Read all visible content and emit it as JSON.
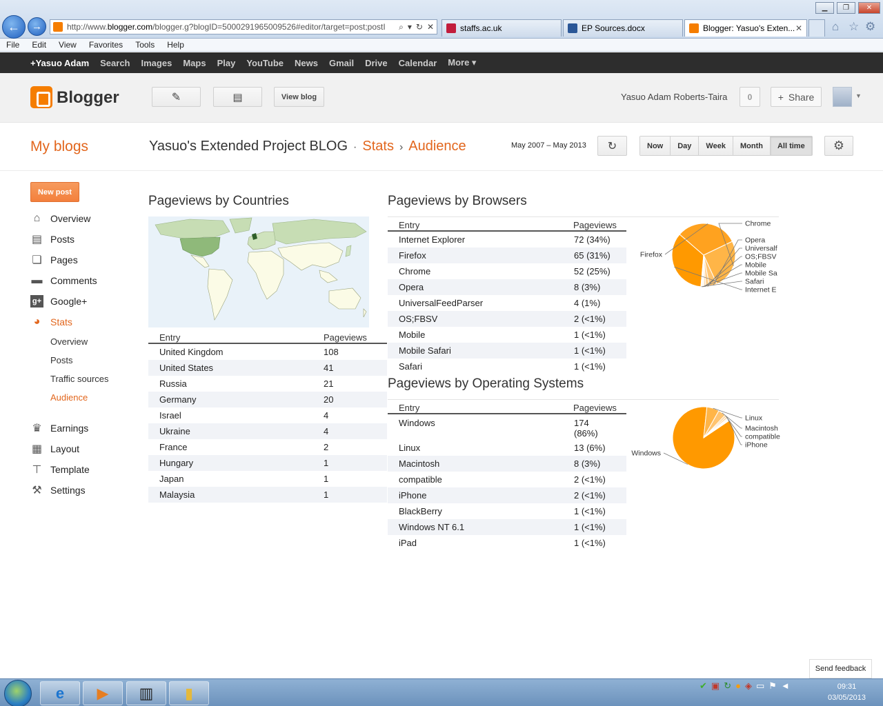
{
  "browser": {
    "address_url_prefix": "http://www.",
    "address_url_domain": "blogger.com",
    "address_url_rest": "/blogger.g?blogID=5000291965009526#editor/target=post;postI",
    "tabs": [
      {
        "title": "staffs.ac.uk",
        "icon": "staffs-icon"
      },
      {
        "title": "EP Sources.docx",
        "icon": "word-icon"
      },
      {
        "title": "Blogger: Yasuo's Exten...",
        "icon": "blogger-icon"
      }
    ],
    "menu": [
      "File",
      "Edit",
      "View",
      "Favorites",
      "Tools",
      "Help"
    ]
  },
  "google_bar": [
    "+Yasuo Adam",
    "Search",
    "Images",
    "Maps",
    "Play",
    "YouTube",
    "News",
    "Gmail",
    "Drive",
    "Calendar",
    "More ▾"
  ],
  "header": {
    "logo": "Blogger",
    "view_blog": "View blog",
    "user_name": "Yasuo Adam Roberts-Taira",
    "notifications": "0",
    "share": "Share"
  },
  "title_row": {
    "my_blogs": "My blogs",
    "blog_name": "Yasuo's Extended Project BLOG",
    "dot_sep": "·",
    "stats": "Stats",
    "arrow_sep": "›",
    "audience": "Audience",
    "date_range": "May 2007 – May 2013",
    "range_buttons": [
      "Now",
      "Day",
      "Week",
      "Month",
      "All time"
    ],
    "range_selected": "All time"
  },
  "sidebar": {
    "new_post": "New post",
    "items": [
      "Overview",
      "Posts",
      "Pages",
      "Comments",
      "Google+",
      "Stats",
      "Earnings",
      "Layout",
      "Template",
      "Settings"
    ],
    "stats_sub": [
      "Overview",
      "Posts",
      "Traffic sources",
      "Audience"
    ]
  },
  "countries": {
    "title": "Pageviews by Countries",
    "col_entry": "Entry",
    "col_pageviews": "Pageviews",
    "rows": [
      {
        "entry": "United Kingdom",
        "views": "108"
      },
      {
        "entry": "United States",
        "views": "41"
      },
      {
        "entry": "Russia",
        "views": "21"
      },
      {
        "entry": "Germany",
        "views": "20"
      },
      {
        "entry": "Israel",
        "views": "4"
      },
      {
        "entry": "Ukraine",
        "views": "4"
      },
      {
        "entry": "France",
        "views": "2"
      },
      {
        "entry": "Hungary",
        "views": "1"
      },
      {
        "entry": "Japan",
        "views": "1"
      },
      {
        "entry": "Malaysia",
        "views": "1"
      }
    ]
  },
  "browsers": {
    "title": "Pageviews by Browsers",
    "col_entry": "Entry",
    "col_pageviews": "Pageviews",
    "rows": [
      {
        "entry": "Internet Explorer",
        "views": "72 (34%)"
      },
      {
        "entry": "Firefox",
        "views": "65 (31%)"
      },
      {
        "entry": "Chrome",
        "views": "52 (25%)"
      },
      {
        "entry": "Opera",
        "views": "8 (3%)"
      },
      {
        "entry": "UniversalFeedParser",
        "views": "4 (1%)"
      },
      {
        "entry": "OS;FBSV",
        "views": "2 (<1%)"
      },
      {
        "entry": "Mobile",
        "views": "1 (<1%)"
      },
      {
        "entry": "Mobile Safari",
        "views": "1 (<1%)"
      },
      {
        "entry": "Safari",
        "views": "1 (<1%)"
      }
    ]
  },
  "os": {
    "title": "Pageviews by Operating Systems",
    "col_entry": "Entry",
    "col_pageviews": "Pageviews",
    "rows": [
      {
        "entry": "Windows",
        "views": "174\n(86%)"
      },
      {
        "entry": "Linux",
        "views": "13 (6%)"
      },
      {
        "entry": "Macintosh",
        "views": "8 (3%)"
      },
      {
        "entry": "compatible",
        "views": "2 (<1%)"
      },
      {
        "entry": "iPhone",
        "views": "2 (<1%)"
      },
      {
        "entry": "BlackBerry",
        "views": "1 (<1%)"
      },
      {
        "entry": "Windows NT 6.1",
        "views": "1 (<1%)"
      },
      {
        "entry": "iPad",
        "views": "1 (<1%)"
      }
    ]
  },
  "chart_data": [
    {
      "type": "pie",
      "labels": [
        "Internet Explorer",
        "Firefox",
        "Chrome",
        "Opera",
        "UniversalFeedParser",
        "OS;FBSV",
        "Mobile",
        "Mobile Safari",
        "Safari"
      ],
      "values": [
        72,
        65,
        52,
        8,
        4,
        2,
        1,
        1,
        1
      ],
      "shown_labels": [
        "Chrome",
        "Opera",
        "Universalf",
        "OS;FBSV",
        "Mobile",
        "Mobile Sa",
        "Safari",
        "Internet E",
        "Firefox"
      ],
      "colors": [
        "#ff9900",
        "#ffa21f",
        "#ffb547",
        "#ffc470",
        "#ffd08f",
        "#ffd9a6",
        "#ffe1b8",
        "#ffe8c9",
        "#ffeed6"
      ]
    },
    {
      "type": "pie",
      "labels": [
        "Windows",
        "Linux",
        "Macintosh",
        "compatible",
        "iPhone",
        "BlackBerry",
        "Windows NT 6.1",
        "iPad"
      ],
      "values": [
        174,
        13,
        8,
        2,
        2,
        1,
        1,
        1
      ],
      "shown_labels": [
        "Linux",
        "Macintosh",
        "compatible",
        "iPhone",
        "Windows"
      ],
      "colors": [
        "#ff9900",
        "#ffb547",
        "#ffc470",
        "#ffd08f",
        "#ffd9a6",
        "#ffe1b8",
        "#ffe8c9",
        "#ffeed6"
      ]
    }
  ],
  "feedback": "Send feedback",
  "clock": {
    "time": "09:31",
    "date": "03/05/2013"
  }
}
